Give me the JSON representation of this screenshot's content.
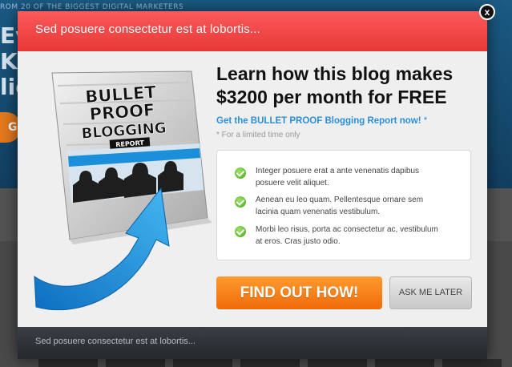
{
  "background": {
    "tagline": "ROM 20 OF THE BIGGEST DIGITAL MARKETERS",
    "lines": [
      "Eve",
      "Kn",
      "lig"
    ],
    "button_label": "G"
  },
  "modal": {
    "header_text": "Sed posuere consectetur est at lobortis...",
    "close_label": "x",
    "ebook": {
      "line1": "BULLET",
      "line2": "PROOF",
      "line3": "BLOGGING",
      "line4": "REPORT"
    },
    "headline_line1": "Learn how this blog makes",
    "headline_line2": "$3200 per month for FREE",
    "cta_link": "Get the BULLET PROOF Blogging Report now!",
    "cta_star": "*",
    "note": "* For a limited time only",
    "benefits": [
      "Integer posuere erat a ante venenatis dapibus posuere velit aliquet.",
      "Aenean eu leo quam. Pellentesque ornare sem lacinia quam venenatis vestibulum.",
      "Morbi leo risus, porta ac consectetur ac, vestibulum at eros. Cras justo odio."
    ],
    "primary_button": "FIND OUT HOW!",
    "secondary_button": "ASK ME LATER",
    "footer_text": "Sed posuere consectetur est at lobortis..."
  },
  "colors": {
    "header_red": "#f24848",
    "cta_blue": "#2a8fd6",
    "button_orange": "#f47f14",
    "check_green": "#5cbf2a"
  }
}
